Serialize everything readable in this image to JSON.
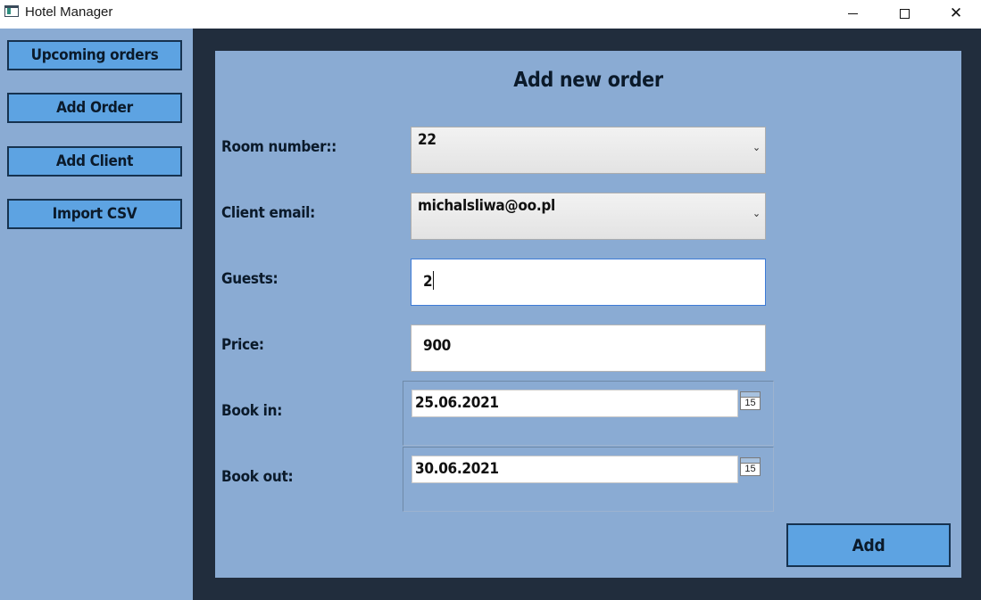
{
  "window": {
    "title": "Hotel Manager",
    "icon": "app-window-icon",
    "controls": {
      "minimize": "minimize-icon",
      "maximize": "maximize-icon",
      "close": "close-icon",
      "close_glyph": "✕"
    }
  },
  "sidebar": {
    "items": [
      {
        "label": "Upcoming orders"
      },
      {
        "label": "Add Order"
      },
      {
        "label": "Add Client"
      },
      {
        "label": "Import CSV"
      }
    ]
  },
  "form": {
    "title": "Add new order",
    "room": {
      "label": "Room number::",
      "value": "22",
      "arrow": "⌄"
    },
    "client": {
      "label": "Client email:",
      "value": "michalsliwa@oo.pl",
      "arrow": "⌄"
    },
    "guests": {
      "label": "Guests:",
      "value": "2"
    },
    "price": {
      "label": "Price:",
      "value": "900"
    },
    "book_in": {
      "label": "Book in:",
      "value": "25.06.2021",
      "calendar_day": "15"
    },
    "book_out": {
      "label": "Book out:",
      "value": "30.06.2021",
      "calendar_day": "15"
    },
    "submit_label": "Add"
  },
  "colors": {
    "panel": "#8aabd3",
    "background_dark": "#212d3d",
    "button": "#5da3e2",
    "button_border": "#16324f"
  }
}
